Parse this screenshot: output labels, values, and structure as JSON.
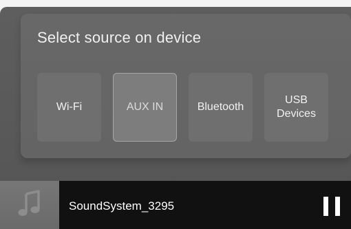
{
  "header": {
    "title": "Select source on device"
  },
  "sources": [
    {
      "label": "Wi-Fi",
      "selected": false
    },
    {
      "label": "AUX IN",
      "selected": true
    },
    {
      "label": "Bluetooth",
      "selected": false
    },
    {
      "label": "USB\nDevices",
      "selected": false
    }
  ],
  "now_playing": {
    "track_name": "SoundSystem_3295",
    "album_art_icon": "music-note-icon",
    "control_icon": "pause-icon"
  }
}
